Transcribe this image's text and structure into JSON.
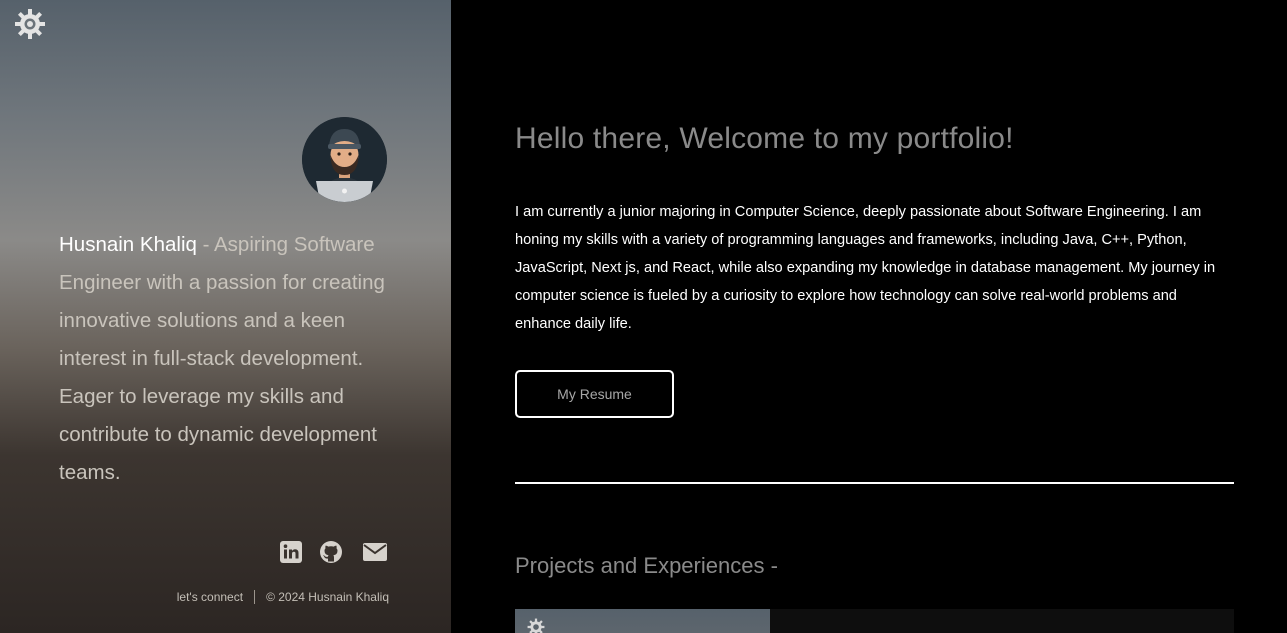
{
  "profile": {
    "name": "Husnain Khaliq",
    "dash": " - ",
    "tagline": "Aspiring Software Engineer with a passion for creating innovative solutions and a keen interest in full-stack development. Eager to leverage my skills and contribute to dynamic development teams."
  },
  "icons": {
    "theme_toggle": "gear-icon",
    "linkedin": "linkedin-icon",
    "github": "github-icon",
    "email": "mail-icon"
  },
  "footer": {
    "connect": "let's connect",
    "copyright": "© 2024 Husnain Khaliq"
  },
  "main": {
    "welcome": "Hello there, Welcome to my portfolio!",
    "intro": "I am currently a junior majoring in Computer Science, deeply passionate about Software Engineering. I am honing my skills with a variety of programming languages and frameworks, including Java, C++, Python, JavaScript, Next js, and React, while also expanding my knowledge in database management. My journey in computer science is fueled by a curiosity to explore how technology can solve real-world problems and enhance daily life.",
    "resume_label": "My Resume",
    "projects_title": "Projects and Experiences -"
  },
  "colors": {
    "background": "#000000",
    "heading_gray": "#8a8a8a",
    "text_white": "#ffffff",
    "icon_gray": "#d6d2cc"
  }
}
